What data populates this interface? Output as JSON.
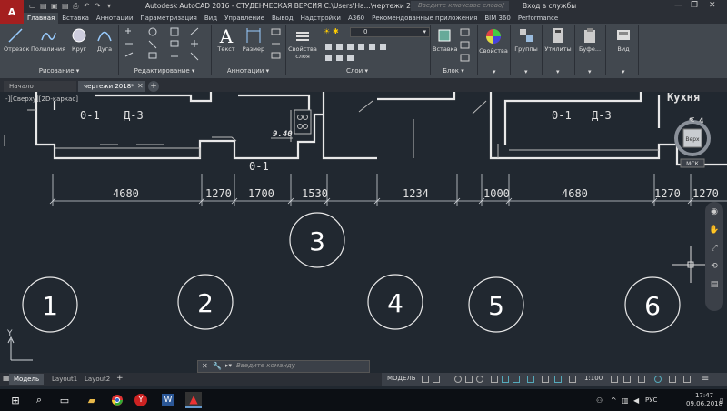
{
  "titlebar": {
    "app_icon": "A",
    "title": "Autodesk AutoCAD 2016 - СТУДЕНЧЕСКАЯ ВЕРСИЯ    C:\\Users\\Ha...\\чертежи 2018.dwg",
    "search_placeholder": "Введите ключевое слово/фразу",
    "signin": "Вход в службы"
  },
  "ribbon_tabs": [
    "Главная",
    "Вставка",
    "Аннотации",
    "Параметризация",
    "Вид",
    "Управление",
    "Вывод",
    "Надстройки",
    "A360",
    "Рекомендованные приложения",
    "BIM 360",
    "Performance"
  ],
  "tools": {
    "line": "Отрезок",
    "polyline": "Полилиния",
    "circle": "Круг",
    "arc": "Дуга",
    "text": "Текст",
    "dimension": "Размер",
    "layer_props": "Свойства\nслоя",
    "insert": "Вставка",
    "properties": "Свойства",
    "groups": "Группы",
    "utilities": "Утилиты",
    "clipboard": "Буфе...",
    "view": "Вид"
  },
  "layer_value": "0",
  "panels": {
    "draw": "Рисование",
    "modify": "Редактирование",
    "annotations": "Аннотации",
    "layers": "Слои",
    "block": "Блок"
  },
  "doc_tabs": {
    "start": "Начало",
    "drawing": "чертежи 2018*"
  },
  "view_label": "-][Сверху][2D-каркас]",
  "drawing": {
    "labels_top": [
      "0-1",
      "Д-3",
      "0-1",
      "Д-3",
      "Кухня",
      "9.4"
    ],
    "area": "9.40",
    "label_01": "0-1",
    "dims": [
      "4680",
      "1270",
      "1700",
      "1530",
      "1234",
      "1000",
      "4680",
      "1270",
      "1270"
    ],
    "axes": [
      "1",
      "2",
      "3",
      "4",
      "5",
      "6"
    ]
  },
  "viewcube": {
    "top": "С",
    "face": "Верх",
    "wcs": "МСК"
  },
  "command": {
    "placeholder": "Введите команду"
  },
  "layout_tabs": [
    "Модель",
    "Layout1",
    "Layout2"
  ],
  "status": {
    "model": "МОДЕЛЬ",
    "scale": "1:100"
  },
  "tray": {
    "lang": "РУС",
    "time": "17:47",
    "date": "09.06.2018"
  }
}
